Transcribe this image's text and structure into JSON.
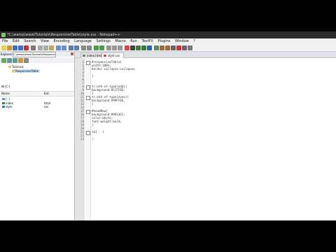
{
  "window": {
    "title": "*C:\\wamp\\www\\Tutorials\\ResponsiveTable\\style.css - Notepad++"
  },
  "menu": [
    "File",
    "Edit",
    "Search",
    "View",
    "Encoding",
    "Language",
    "Settings",
    "Macro",
    "Run",
    "TextFX",
    "Plugins",
    "Window",
    "?"
  ],
  "explorer": {
    "label": "Explorer",
    "path": "C:\\wamp\\www\\Tutorials\\Responsive",
    "tree": [
      "Tutorials",
      "ResponsiveTable"
    ],
    "drive_label": "(C:)",
    "columns": [
      "Name",
      "Ext."
    ],
    "up_label": "[..]",
    "files": [
      {
        "name": "index",
        "ext": "html"
      },
      {
        "name": "style",
        "ext": "css"
      }
    ]
  },
  "tabs": [
    {
      "label": "index.html",
      "active": false
    },
    {
      "label": "style.css",
      "active": true
    }
  ],
  "editor": {
    "line_numbers": [
      "1",
      "2",
      "3",
      "4",
      "5",
      "6",
      "7",
      "8",
      "9",
      "10",
      "11",
      "12",
      "13",
      "14",
      "15",
      "16",
      "17",
      "18",
      "19",
      "20",
      "21",
      "22",
      "23"
    ],
    "lines": [
      "#responsiveTable{",
      "width:100%;",
      "border-collapse:collapse;",
      "",
      "}",
      "",
      "",
      "tr:nth-of-type(odd){",
      "background:#CCFFEE;",
      "}",
      "tr:nth-of-type(even){",
      "background:#99FFEE;",
      "}",
      "",
      "#headRow{",
      "background:#9933CC;",
      "color:white;",
      "font-weight:bold;",
      "}",
      "",
      "td{   }",
      "",
      "|"
    ]
  }
}
